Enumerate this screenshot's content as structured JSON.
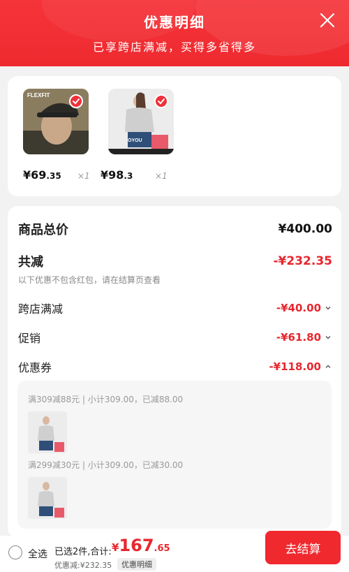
{
  "header": {
    "title": "优惠明细",
    "subtitle": "已享跨店满减，买得多省得多",
    "close_icon": "close-icon"
  },
  "products": [
    {
      "name": "product-flexfit-cap",
      "price_int": "¥69",
      "price_dec": ".35",
      "qty": "×1",
      "checked": true
    },
    {
      "name": "product-sweater-jeans",
      "price_int": "¥98",
      "price_dec": ".3",
      "qty": "×1",
      "checked": true
    }
  ],
  "summary": {
    "total_label": "商品总价",
    "total_value": "¥400.00",
    "reduce_label": "共减",
    "reduce_value": "-¥232.35",
    "note": "以下优惠不包含红包，请在结算页查看",
    "cross_store_label": "跨店满减",
    "cross_store_value": "-¥40.00",
    "promo_label": "促销",
    "promo_value": "-¥61.80",
    "coupon_label": "优惠券",
    "coupon_value": "-¥118.00"
  },
  "coupons": [
    {
      "text": "满309减88元 | 小计309.00，已减88.00"
    },
    {
      "text": "满299减30元 | 小计309.00，已减30.00"
    }
  ],
  "bottom": {
    "select_all": "全选",
    "selected_text": "已选2件,合计:",
    "currency": "¥",
    "total_int": "167",
    "total_dec": ".65",
    "discount_text": "优惠减:¥232.35",
    "detail_tag": "优惠明细",
    "checkout": "去结算"
  },
  "colors": {
    "accent": "#f0292f",
    "price_red": "#e8262d"
  }
}
